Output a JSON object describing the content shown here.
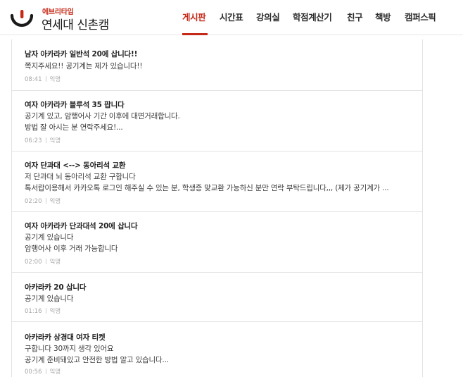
{
  "brand": {
    "school": "에브리타임",
    "name": "연세대 신촌캠"
  },
  "colors": {
    "accent": "#c62917",
    "text": "#292929",
    "muted": "#a6a6a6",
    "border": "#e3e3e3"
  },
  "nav": {
    "items": [
      {
        "label": "게시판",
        "active": true
      },
      {
        "label": "시간표",
        "active": false
      },
      {
        "label": "강의실",
        "active": false
      },
      {
        "label": "학점계산기",
        "active": false
      },
      {
        "label": "친구",
        "active": false
      },
      {
        "label": "책방",
        "active": false
      },
      {
        "label": "캠퍼스픽",
        "active": false
      }
    ]
  },
  "posts": [
    {
      "title": "남자 아카라카 일반석 20에 삽니다!!",
      "lines": [
        "쪽지주세요!! 공기계는 제가 있습니다!!"
      ],
      "time": "08:41",
      "author": "익명"
    },
    {
      "title": "여자 아카라카 블루석 35 팝니다",
      "lines": [
        "공기계 있고, 암행어사 기간 이후에 대면거래합니다.",
        "방법 잘 아시는 분 연락주세요!..."
      ],
      "time": "06:23",
      "author": "익명"
    },
    {
      "title": "여자 단과대 <--> 동아리석 교환",
      "lines": [
        "저 단과대 뇌 동아리석 교환 구합니다",
        "톡서랍이용해서 카카오톡 로그인 해주실 수 있는 분, 학생증 맞교환 가능하신 분만 연락 부탁드립니다,,, (제가 공기계가 ..."
      ],
      "time": "02:20",
      "author": "익명"
    },
    {
      "title": "여자 아카라카 단과대석 20에 삽니다",
      "lines": [
        "공기계 있습니다",
        "암행어사 이후 거래 가능합니다"
      ],
      "time": "02:00",
      "author": "익명"
    },
    {
      "title": "아카라카 20 삽니다",
      "lines": [
        "공기계 있습니다"
      ],
      "time": "01:16",
      "author": "익명"
    },
    {
      "title": "아카라카 상경대 여자 티켓",
      "lines": [
        "구합니다 30까지 생각 있어요",
        "공기계 준비돼있고 안전한 방법 알고 있습니다..."
      ],
      "time": "00:56",
      "author": "익명"
    }
  ]
}
